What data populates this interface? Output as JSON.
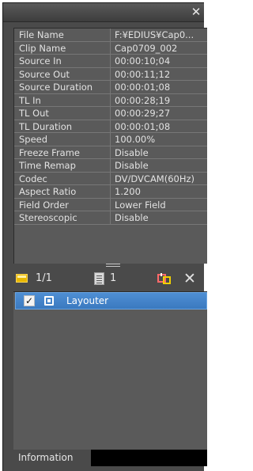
{
  "titlebar": {
    "close_icon": "close-icon"
  },
  "properties": [
    {
      "key": "File Name",
      "value": "F:¥EDIUS¥Cap0..."
    },
    {
      "key": "Clip Name",
      "value": "Cap0709_002"
    },
    {
      "key": "Source In",
      "value": "00:00:10;04"
    },
    {
      "key": "Source Out",
      "value": "00:00:11;12"
    },
    {
      "key": "Source Duration",
      "value": "00:00:01;08"
    },
    {
      "key": "TL In",
      "value": "00:00:28;19"
    },
    {
      "key": "TL Out",
      "value": "00:00:29;27"
    },
    {
      "key": "TL Duration",
      "value": "00:00:01;08"
    },
    {
      "key": "Speed",
      "value": "100.00%"
    },
    {
      "key": "Freeze Frame",
      "value": "Disable"
    },
    {
      "key": "Time Remap",
      "value": "Disable"
    },
    {
      "key": "Codec",
      "value": "DV/DVCAM(60Hz)"
    },
    {
      "key": "Aspect Ratio",
      "value": "1.200"
    },
    {
      "key": "Field Order",
      "value": "Lower Field"
    },
    {
      "key": "Stereoscopic",
      "value": "Disable"
    }
  ],
  "toolbar": {
    "layout_count": "1/1",
    "effect_count": "1",
    "icons": [
      "layouter-icon",
      "document-icon",
      "effect-settings-icon",
      "remove-icon"
    ]
  },
  "effects": [
    {
      "label": "Layouter",
      "checked": true,
      "check_mark": "✓"
    }
  ],
  "tabs": [
    {
      "label": "Information"
    }
  ],
  "colors": {
    "panel": "#5a5a5a",
    "selection": "#3a79bf",
    "layout_icon": "#e9b800"
  }
}
